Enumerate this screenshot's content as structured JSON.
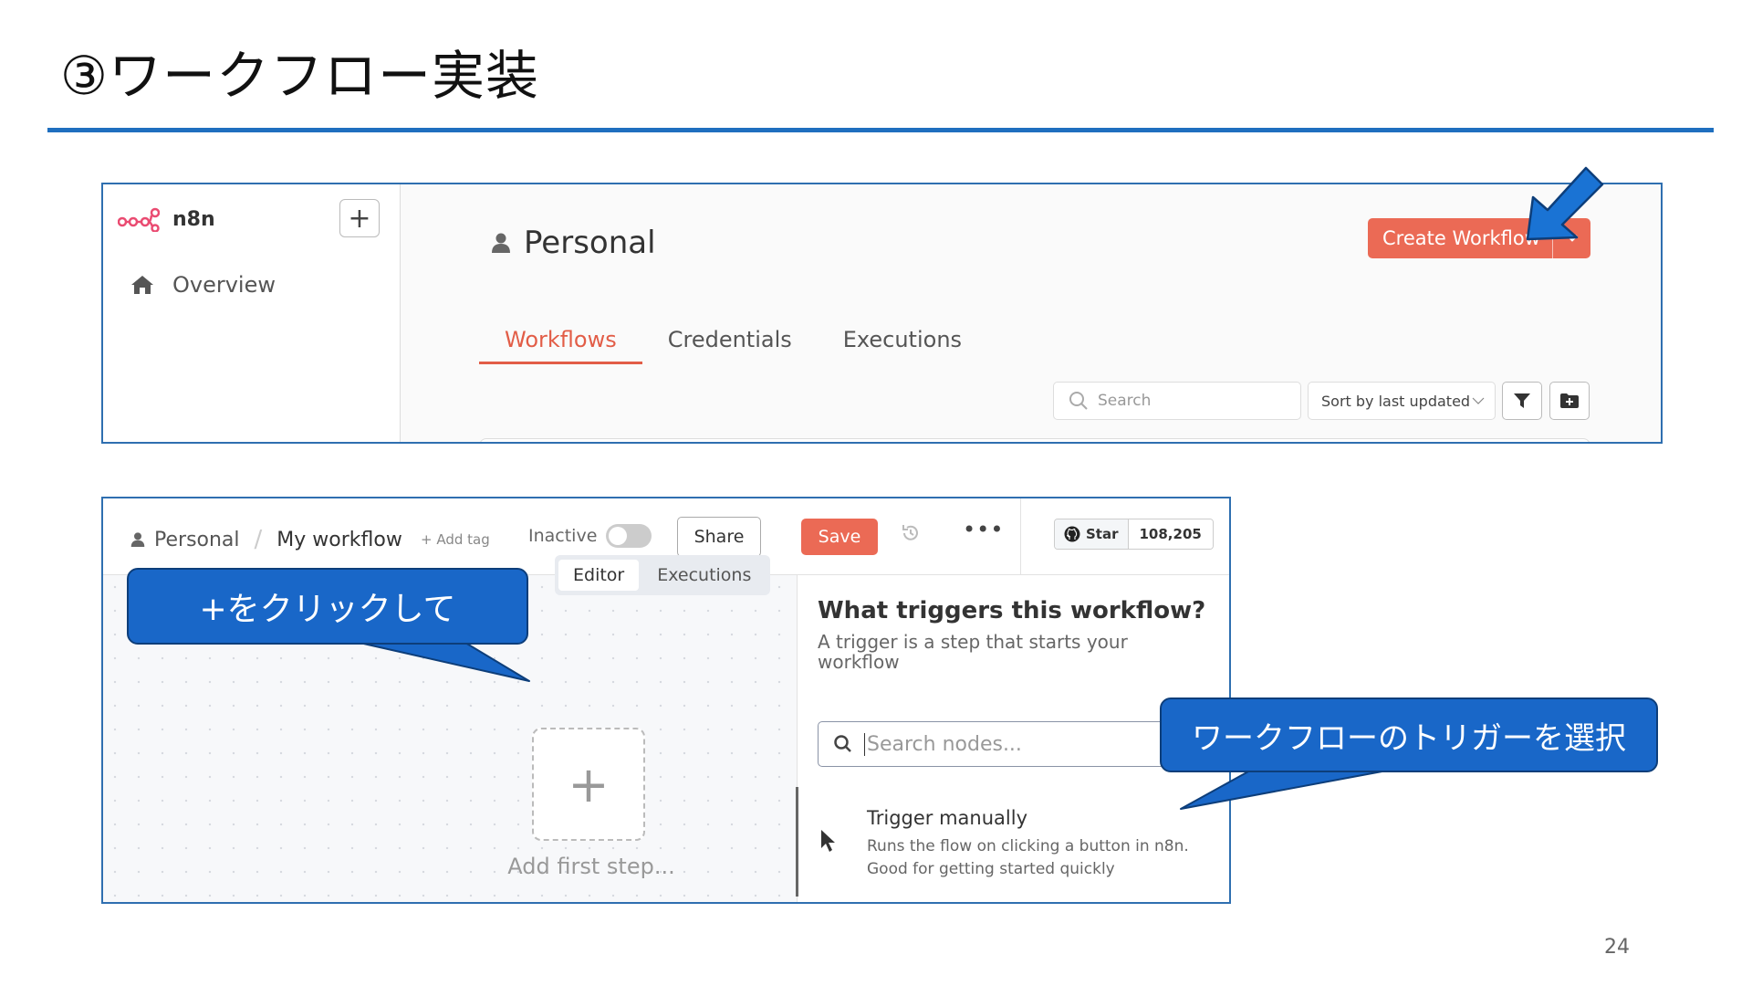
{
  "slide": {
    "title": "③ワークフロー実装",
    "page_number": "24",
    "accent_color": "#1f6fbf"
  },
  "shot1": {
    "app_name": "n8n",
    "add_button": "+",
    "nav_overview": "Overview",
    "section_title": "Personal",
    "tabs": [
      {
        "label": "Workflows",
        "active": true
      },
      {
        "label": "Credentials",
        "active": false
      },
      {
        "label": "Executions",
        "active": false
      }
    ],
    "create_button": "Create Workflow",
    "search_placeholder": "Search",
    "sort_label": "Sort by last updated",
    "brand_color": "#eb6a55"
  },
  "shot2": {
    "breadcrumb_project": "Personal",
    "breadcrumb_separator": "/",
    "breadcrumb_workflow": "My workflow",
    "add_tag": "+ Add tag",
    "status_label": "Inactive",
    "share_button": "Share",
    "save_button": "Save",
    "more_button": "•••",
    "star_label": "Star",
    "star_count": "108,205",
    "modes": [
      {
        "label": "Editor",
        "active": true
      },
      {
        "label": "Executions",
        "active": false
      }
    ],
    "add_step_symbol": "+",
    "add_step_text": "Add first step...",
    "panel_title": "What triggers this workflow?",
    "panel_subtitle": "A trigger is a step that starts your workflow",
    "node_search_placeholder": "Search nodes...",
    "trigger_title": "Trigger manually",
    "trigger_description": "Runs the flow on clicking a button in n8n. Good for getting started quickly"
  },
  "callouts": {
    "first": "+をクリックして",
    "second": "ワークフローのトリガーを選択",
    "fill_color": "#1967c8"
  }
}
